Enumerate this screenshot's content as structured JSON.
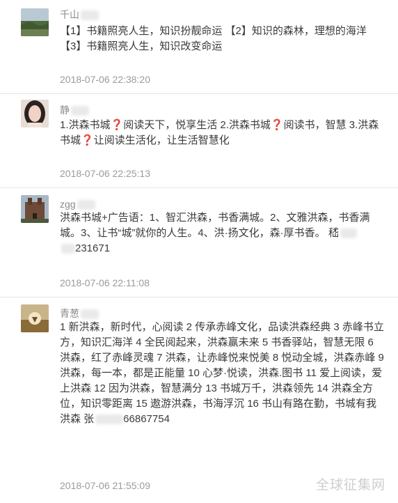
{
  "comments": [
    {
      "name": "千山",
      "text": "【1】书籍照亮人生，知识扮靓命运 【2】知识的森林，理想的海洋 【3】书籍照亮人生，知识改变命运",
      "time": "2018-07-06 22:38:20"
    },
    {
      "name": "静",
      "seg1": "1.洪森书城",
      "seg2": "阅读天下，悦享生活 2.洪森书城",
      "seg3": "阅读书，智慧 3.洪森书城",
      "seg4": "让阅读生活化，让生活智慧化",
      "qmark": "❓",
      "time": "2018-07-06 22:25:13"
    },
    {
      "name": "zgg",
      "text1": "洪森书城+广告语：1、智汇洪森，书香满城。2、文雅洪森，书香满城。3、让书“城”就你的人生。4、洪·扬文化，森·厚书香。 嵇",
      "text2": "231671",
      "time": "2018-07-06 22:11:08"
    },
    {
      "name": "青葱",
      "text1": "1 新洪森，新时代，心阅读 2 传承赤峰文化，品读洪森经典 3 赤峰书立方，知识汇海洋 4 全民阅起来，洪森赢未来 5 书香驿站，智慧无限 6 洪森，红了赤峰灵魂 7 洪森，让赤峰悦来悦美 8 悦动全城，洪森赤峰 9 洪森，每一本，都是正能量 10 心梦·悦读，洪森.图书 11 爱上阅读，爱上洪森 12 因为洪森，智慧满分 13 书城万千，洪森领先 14 洪森全方位，知识零距离 15 遨游洪森，书海浮沉 16 书山有路在勤，书城有我洪森 张",
      "text2": "66867754",
      "time": "2018-07-06 21:55:09"
    }
  ],
  "watermark": "全球征集网"
}
